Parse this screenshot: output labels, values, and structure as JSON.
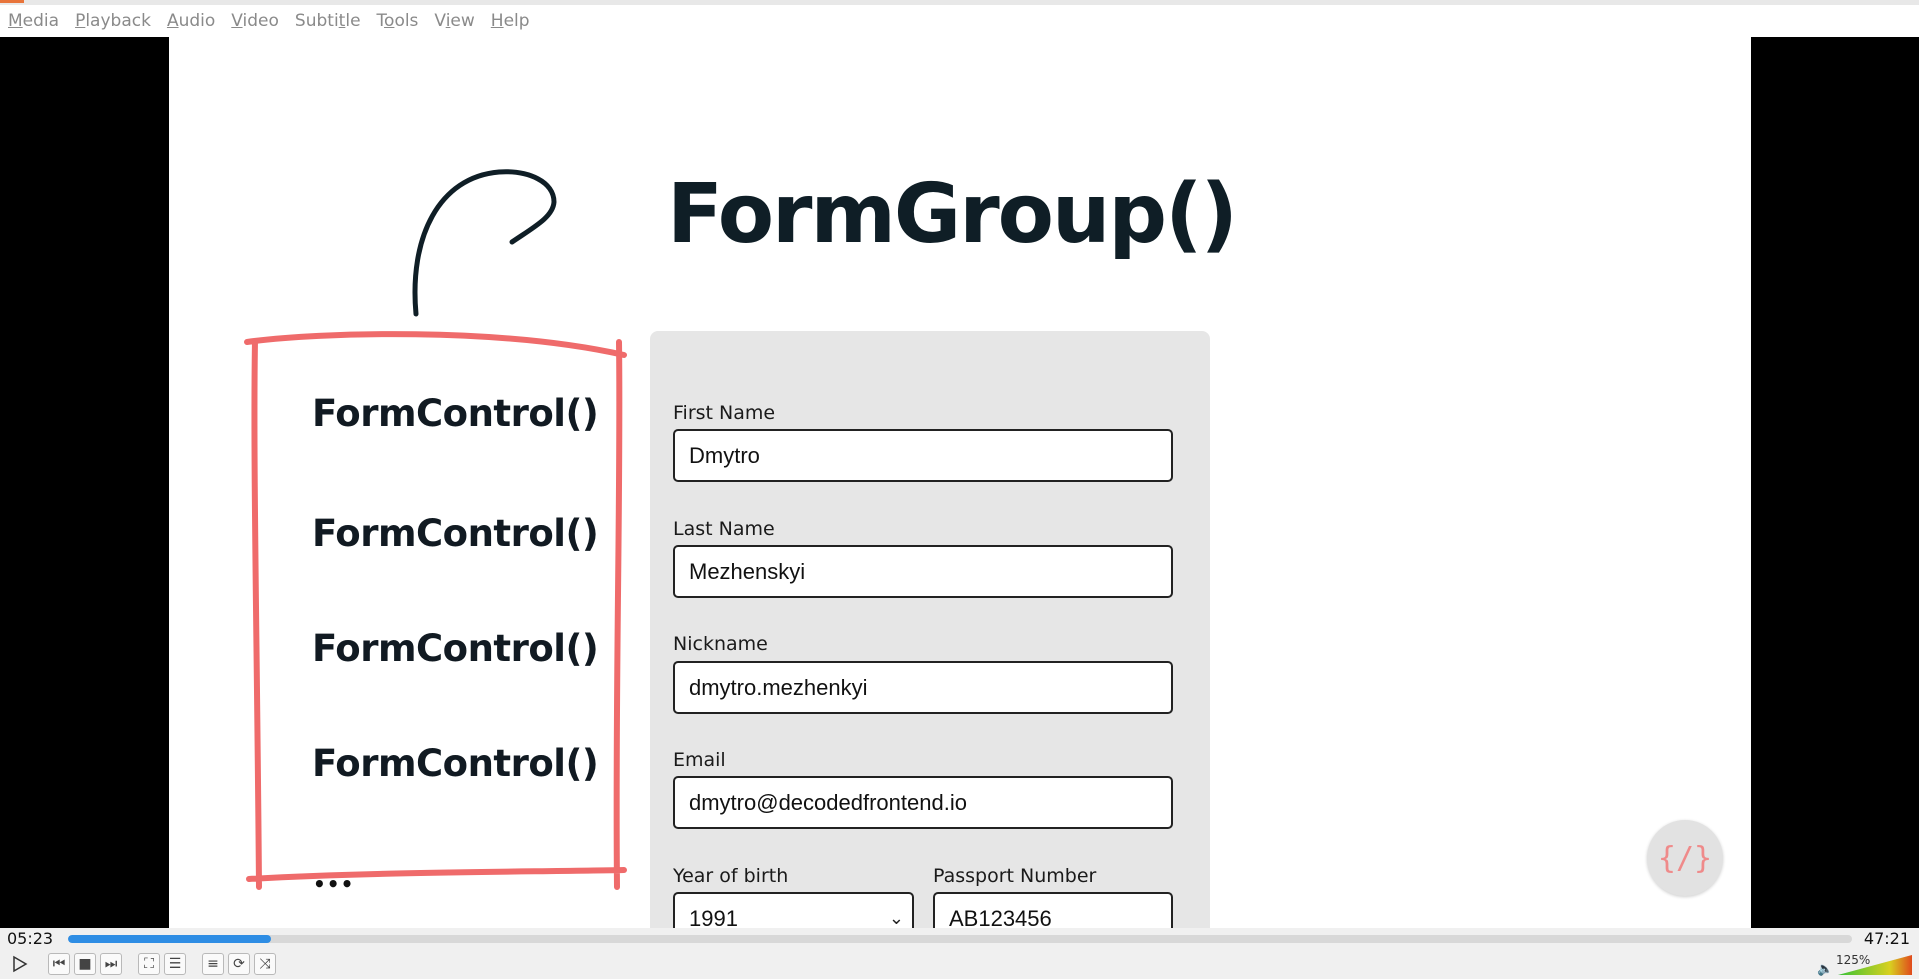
{
  "menu": {
    "items": [
      {
        "pre": "",
        "u": "M",
        "post": "edia"
      },
      {
        "pre": "",
        "u": "P",
        "post": "layback"
      },
      {
        "pre": "",
        "u": "A",
        "post": "udio"
      },
      {
        "pre": "",
        "u": "V",
        "post": "ideo"
      },
      {
        "pre": "Subti",
        "u": "t",
        "post": "le"
      },
      {
        "pre": "T",
        "u": "o",
        "post": "ols"
      },
      {
        "pre": "V",
        "u": "i",
        "post": "ew"
      },
      {
        "pre": "",
        "u": "H",
        "post": "elp"
      }
    ]
  },
  "slide": {
    "title": "FormGroup()",
    "controls": [
      "FormControl()",
      "FormControl()",
      "FormControl()",
      "FormControl()"
    ],
    "ellipsis": "•••",
    "logo": "{/}",
    "form": {
      "first_name": {
        "label": "First Name",
        "value": "Dmytro"
      },
      "last_name": {
        "label": "Last Name",
        "value": "Mezhenskyi"
      },
      "nickname": {
        "label": "Nickname",
        "value": "dmytro.mezhenkyi"
      },
      "email": {
        "label": "Email",
        "value": "dmytro@decodedfrontend.io"
      },
      "year_of_birth": {
        "label": "Year of birth",
        "value": "1991"
      },
      "passport": {
        "label": "Passport Number",
        "value": "AB123456"
      }
    }
  },
  "player": {
    "elapsed": "05:23",
    "total": "47:21",
    "progress_fraction": 0.114,
    "volume_label": "125%",
    "volume_level": 1.25,
    "accent_color": "#2e8de4"
  }
}
